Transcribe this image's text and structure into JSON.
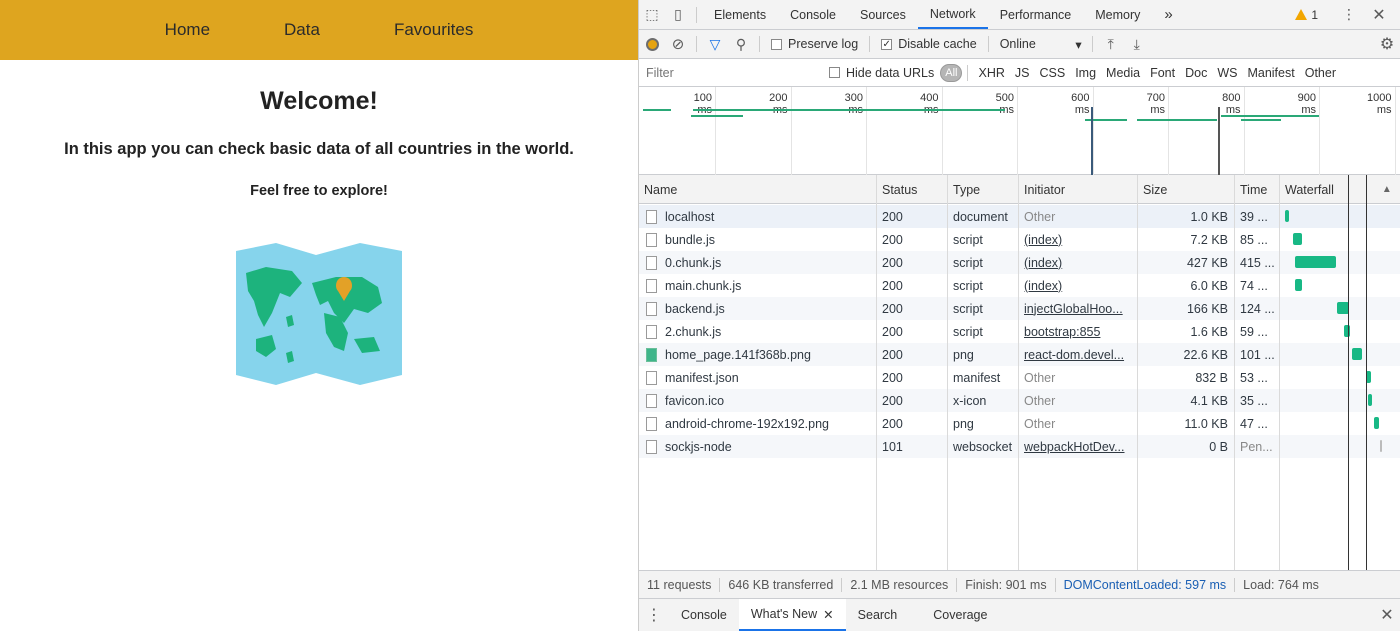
{
  "app": {
    "nav": [
      "Home",
      "Data",
      "Favourites"
    ],
    "heading": "Welcome!",
    "lead": "In this app you can check basic data of all countries in the world.",
    "sub": "Feel free to explore!"
  },
  "devtools": {
    "tabs": [
      "Elements",
      "Console",
      "Sources",
      "Network",
      "Performance",
      "Memory"
    ],
    "active_tab": "Network",
    "more_tabs": "»",
    "warning_count": "1",
    "toolbar": {
      "preserve_log": "Preserve log",
      "disable_cache": "Disable cache",
      "throttle": "Online"
    },
    "filter": {
      "placeholder": "Filter",
      "hide_data_urls": "Hide data URLs",
      "types": [
        "All",
        "XHR",
        "JS",
        "CSS",
        "Img",
        "Media",
        "Font",
        "Doc",
        "WS",
        "Manifest",
        "Other"
      ]
    },
    "timeline_ticks": [
      "100 ms",
      "200 ms",
      "300 ms",
      "400 ms",
      "500 ms",
      "600 ms",
      "700 ms",
      "800 ms",
      "900 ms",
      "1000 ms"
    ],
    "columns": [
      "Name",
      "Status",
      "Type",
      "Initiator",
      "Size",
      "Time",
      "Waterfall"
    ],
    "rows": [
      {
        "name": "localhost",
        "status": "200",
        "type": "document",
        "initiator": "Other",
        "size": "1.0 KB",
        "time": "39 ...",
        "wf_start": 0.01,
        "wf_len": 0.04,
        "icon": "doc"
      },
      {
        "name": "bundle.js",
        "status": "200",
        "type": "script",
        "initiator": "(index)",
        "size": "7.2 KB",
        "time": "85 ...",
        "wf_start": 0.09,
        "wf_len": 0.09,
        "icon": "doc"
      },
      {
        "name": "0.chunk.js",
        "status": "200",
        "type": "script",
        "initiator": "(index)",
        "size": "427 KB",
        "time": "415 ...",
        "wf_start": 0.11,
        "wf_len": 0.41,
        "icon": "doc"
      },
      {
        "name": "main.chunk.js",
        "status": "200",
        "type": "script",
        "initiator": "(index)",
        "size": "6.0 KB",
        "time": "74 ...",
        "wf_start": 0.11,
        "wf_len": 0.07,
        "icon": "doc"
      },
      {
        "name": "backend.js",
        "status": "200",
        "type": "script",
        "initiator": "injectGlobalHoo...",
        "size": "166 KB",
        "time": "124 ...",
        "wf_start": 0.53,
        "wf_len": 0.12,
        "icon": "doc"
      },
      {
        "name": "2.chunk.js",
        "status": "200",
        "type": "script",
        "initiator": "bootstrap:855",
        "size": "1.6 KB",
        "time": "59 ...",
        "wf_start": 0.6,
        "wf_len": 0.06,
        "icon": "doc"
      },
      {
        "name": "home_page.141f368b.png",
        "status": "200",
        "type": "png",
        "initiator": "react-dom.devel...",
        "size": "22.6 KB",
        "time": "101 ...",
        "wf_start": 0.68,
        "wf_len": 0.1,
        "icon": "img"
      },
      {
        "name": "manifest.json",
        "status": "200",
        "type": "manifest",
        "initiator": "Other",
        "size": "832 B",
        "time": "53 ...",
        "wf_start": 0.82,
        "wf_len": 0.05,
        "icon": "doc"
      },
      {
        "name": "favicon.ico",
        "status": "200",
        "type": "x-icon",
        "initiator": "Other",
        "size": "4.1 KB",
        "time": "35 ...",
        "wf_start": 0.84,
        "wf_len": 0.04,
        "icon": "doc"
      },
      {
        "name": "android-chrome-192x192.png",
        "status": "200",
        "type": "png",
        "initiator": "Other",
        "size": "11.0 KB",
        "time": "47 ...",
        "wf_start": 0.9,
        "wf_len": 0.05,
        "icon": "doc"
      },
      {
        "name": "sockjs-node",
        "status": "101",
        "type": "websocket",
        "initiator": "webpackHotDev...",
        "size": "0 B",
        "time": "Pen...",
        "wf_start": 0.96,
        "wf_len": 0.0,
        "icon": "doc"
      }
    ],
    "summary": {
      "requests": "11 requests",
      "transferred": "646 KB transferred",
      "resources": "2.1 MB resources",
      "finish": "Finish: 901 ms",
      "dcl": "DOMContentLoaded: 597 ms",
      "load": "Load: 764 ms"
    },
    "drawer_tabs": [
      "Console",
      "What's New",
      "Search",
      "Coverage"
    ],
    "drawer_active": "What's New",
    "colors": {
      "accent": "#1a73e8",
      "bar": "#18b885",
      "nav": "#dea51f"
    }
  }
}
